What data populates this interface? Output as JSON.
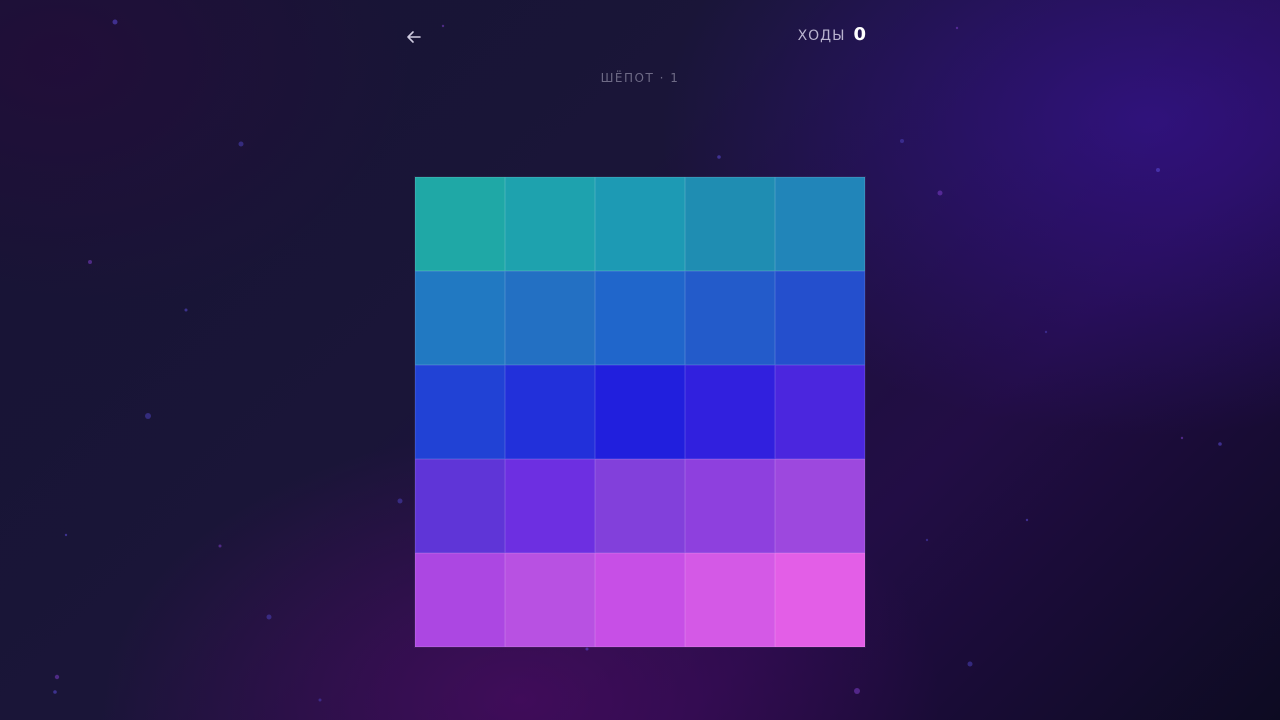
{
  "header": {
    "back_icon": "arrow-left-icon",
    "moves_label": "ХОДЫ",
    "moves_value": "0",
    "level_label": "ШЁПОТ · 1"
  },
  "colors": {
    "text_primary": "#ffffff",
    "text_muted": "#6e6a86"
  },
  "board": {
    "rows": 5,
    "cols": 5,
    "tiles": [
      [
        "#1fa8a6",
        "#1ea2ae",
        "#1d9ab4",
        "#1f8db2",
        "#2185b9"
      ],
      [
        "#2179c2",
        "#2370c3",
        "#2066cb",
        "#235bca",
        "#244fcd"
      ],
      [
        "#2142d5",
        "#2230da",
        "#211fdd",
        "#3120de",
        "#4b26de"
      ],
      [
        "#5f35d7",
        "#6d2fe1",
        "#8240db",
        "#8e40de",
        "#9d48de"
      ],
      [
        "#ac47e2",
        "#b851e2",
        "#c74fe6",
        "#d459e6",
        "#e35ee7"
      ]
    ]
  }
}
